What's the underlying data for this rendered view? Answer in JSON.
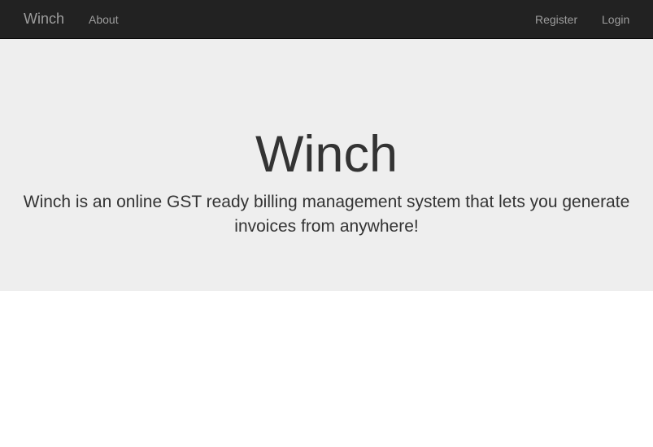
{
  "navbar": {
    "brand": "Winch",
    "left_links": [
      "About"
    ],
    "right_links": [
      "Register",
      "Login"
    ]
  },
  "hero": {
    "title": "Winch",
    "tagline": "Winch is an online GST ready billing management system that lets you generate invoices from anywhere!"
  },
  "colors": {
    "navbar_bg": "#222222",
    "nav_text": "#9d9d9d",
    "jumbotron_bg": "#eeeeee",
    "text": "#333333"
  }
}
